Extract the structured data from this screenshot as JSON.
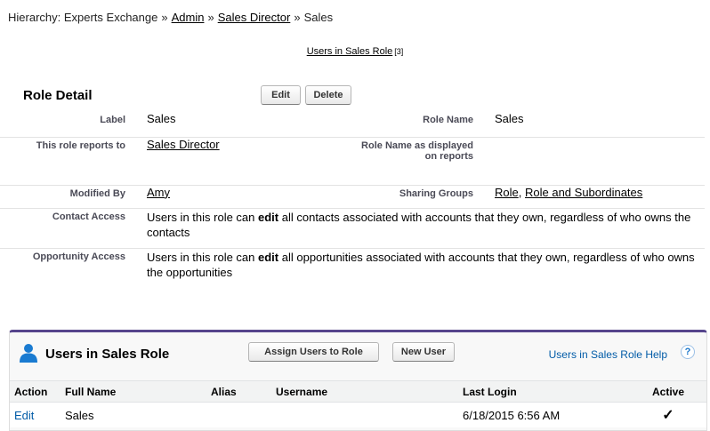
{
  "breadcrumb": {
    "prefix": "Hierarchy: Experts Exchange",
    "separator": "»",
    "links": [
      "Admin",
      "Sales Director"
    ],
    "current": "Sales"
  },
  "related_link": {
    "label": "Users in Sales Role",
    "count": "[3]"
  },
  "role_detail": {
    "title": "Role Detail",
    "edit_button": "Edit",
    "delete_button": "Delete",
    "fields": {
      "label_label": "Label",
      "label_value": "Sales",
      "role_name_label": "Role Name",
      "role_name_value": "Sales",
      "reports_to_label": "This role reports to",
      "reports_to_value": "Sales Director",
      "display_name_label": "Role Name as displayed on reports",
      "display_name_value": "",
      "modified_by_label": "Modified By",
      "modified_by_value": "Amy",
      "sharing_groups_label": "Sharing Groups",
      "sharing_group_1": "Role",
      "sharing_group_sep": ",",
      "sharing_group_2": "Role and Subordinates",
      "contact_access_label": "Contact Access",
      "contact_access_pre": "Users in this role can ",
      "contact_access_bold": "edit",
      "contact_access_post": " all contacts associated with accounts that they own, regardless of who owns the contacts",
      "opp_access_label": "Opportunity Access",
      "opp_access_pre": "Users in this role can ",
      "opp_access_bold": "edit",
      "opp_access_post": " all opportunities associated with accounts that they own, regardless of who owns the opportunities"
    }
  },
  "users_panel": {
    "title": "Users in Sales Role",
    "assign_button": "Assign Users to Role",
    "new_user_button": "New User",
    "help_link": "Users in Sales Role Help",
    "help_icon": "?",
    "columns": [
      "Action",
      "Full Name",
      "Alias",
      "Username",
      "Last Login",
      "Active"
    ],
    "rows": [
      {
        "action": "Edit",
        "full_name": "Sales",
        "alias": "",
        "username": "",
        "last_login": "6/18/2015 6:56 AM",
        "active": "✓"
      }
    ]
  },
  "colors": {
    "panel_accent": "#56458c",
    "link_blue": "#015ba7",
    "icon_blue": "#1a7bd1"
  },
  "icons": {
    "panel_icon": "user-icon",
    "help_icon": "help-icon",
    "active_check": "checkmark-icon"
  }
}
